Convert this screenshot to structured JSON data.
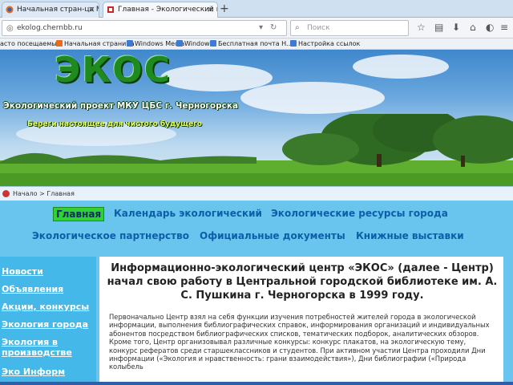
{
  "browser": {
    "tabs": [
      {
        "title": "Начальная стран-ца Mozilla ..."
      },
      {
        "title": "Главная - Экологический ин..."
      }
    ],
    "new_tab_symbol": "+",
    "url": "ekolog.chernbb.ru",
    "search_placeholder": "Поиск",
    "bookmarks": [
      {
        "label": "асто посещаемые"
      },
      {
        "label": "Начальная страница"
      },
      {
        "label": "Windows Media"
      },
      {
        "label": "Windows"
      },
      {
        "label": "Бесплатная почта H..."
      },
      {
        "label": "Настройка ссылок"
      }
    ]
  },
  "banner": {
    "logo": "ЭКОС",
    "subtitle": "Экологический проект МКУ ЦБС г. Черногорска",
    "slogan": "Береги настоящее для чистого будущего"
  },
  "breadcrumb": "Начало > Главная",
  "main_nav": [
    {
      "label": "Главная"
    },
    {
      "label": "Календарь экологический"
    },
    {
      "label": "Экологические ресурсы города"
    },
    {
      "label": "Экологическое партнерство"
    },
    {
      "label": "Официальные документы"
    },
    {
      "label": "Книжные выставки"
    }
  ],
  "sidebar": [
    {
      "label": "Новости"
    },
    {
      "label": "Объявления"
    },
    {
      "label": "Акции, конкурсы"
    },
    {
      "label": "Экология города"
    },
    {
      "label": "Экология в"
    },
    {
      "label": "производстве"
    },
    {
      "label": "Эко Информ"
    }
  ],
  "article": {
    "title": "Информационно-экологический центр «ЭКОС» (далее - Центр) начал свою работу в Центральной городской библиотеке им. А. С. Пушкина г. Черногорска в 1999 году.",
    "body": "Первоначально Центр взял на себя функции изучения потребностей жителей города в экологической информации, выполнения библиографических справок, информирования организаций и индивидуальных абонентов посредством библиографических списков, тематических подборок, аналитических обзоров. Кроме того, Центр организовывал различные конкурсы: конкурс плакатов, на экологическую тему, конкурс рефератов среди старшеклассников и студентов. При активном участии Центра проходили Дни информации («Экология и нравственность: грани взаимодействия»), Дни библиографии («Природа колыбель"
  }
}
